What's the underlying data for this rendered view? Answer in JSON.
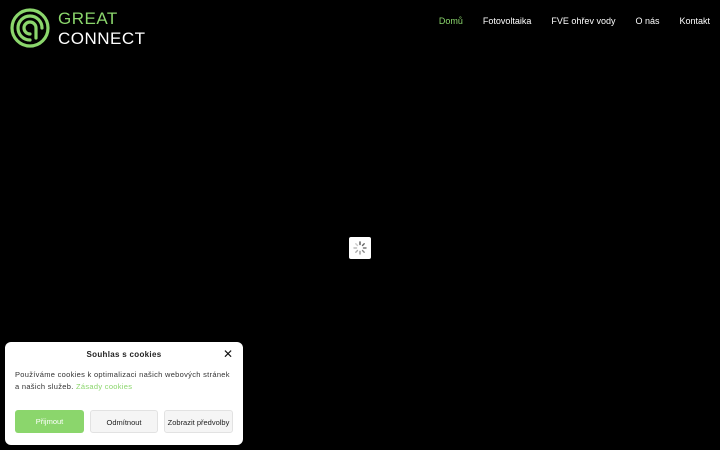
{
  "brand": {
    "line1": "GREAT",
    "line2": "CONNECT",
    "accent_color": "#8bd66c"
  },
  "nav": {
    "items": [
      {
        "label": "Domů",
        "active": true
      },
      {
        "label": "Fotovoltaika",
        "active": false
      },
      {
        "label": "FVE ohřev vody",
        "active": false
      },
      {
        "label": "O nás",
        "active": false
      },
      {
        "label": "Kontakt",
        "active": false
      }
    ]
  },
  "loader": {
    "icon": "spinner-icon"
  },
  "cookie": {
    "title": "Souhlas s cookies",
    "close_icon": "close-icon",
    "text": "Používáme cookies k optimalizaci našich webových stránek a našich služeb.",
    "link": "Zásady cookies",
    "accept_label": "Přijmout",
    "deny_label": "Odmítnout",
    "prefs_label": "Zobrazit předvolby"
  }
}
